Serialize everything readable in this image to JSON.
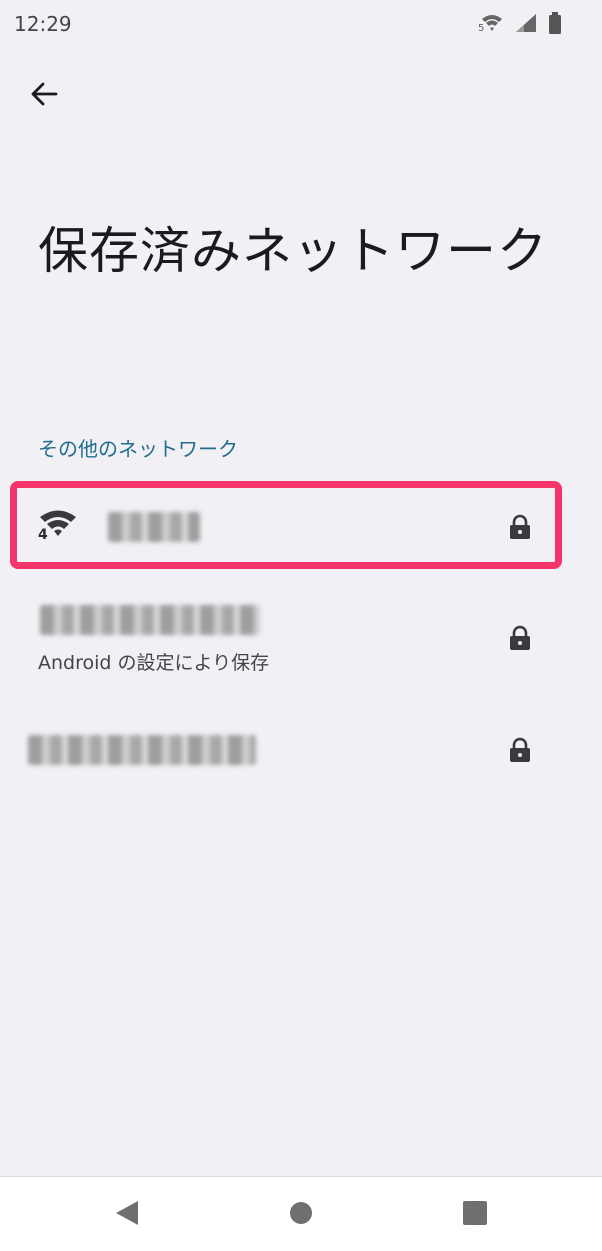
{
  "status_bar": {
    "time": "12:29",
    "wifi_label": "5",
    "icons": [
      "wifi-icon",
      "signal-icon",
      "battery-icon"
    ]
  },
  "header": {
    "back_icon": "arrow-left-icon",
    "title": "保存済みネットワーク"
  },
  "section": {
    "label": "その他のネットワーク"
  },
  "networks": [
    {
      "name": "",
      "signal_level": "4",
      "subtitle": "",
      "locked": true,
      "highlighted": true
    },
    {
      "name": "",
      "subtitle": "Android の設定により保存",
      "locked": true
    },
    {
      "name": "",
      "subtitle": "",
      "locked": true
    }
  ],
  "nav_bar": {
    "icons": [
      "back-triangle-icon",
      "home-circle-icon",
      "recents-square-icon"
    ]
  },
  "colors": {
    "background": "#f1f0f4",
    "accent": "#236e8c",
    "highlight": "#f6346c"
  }
}
